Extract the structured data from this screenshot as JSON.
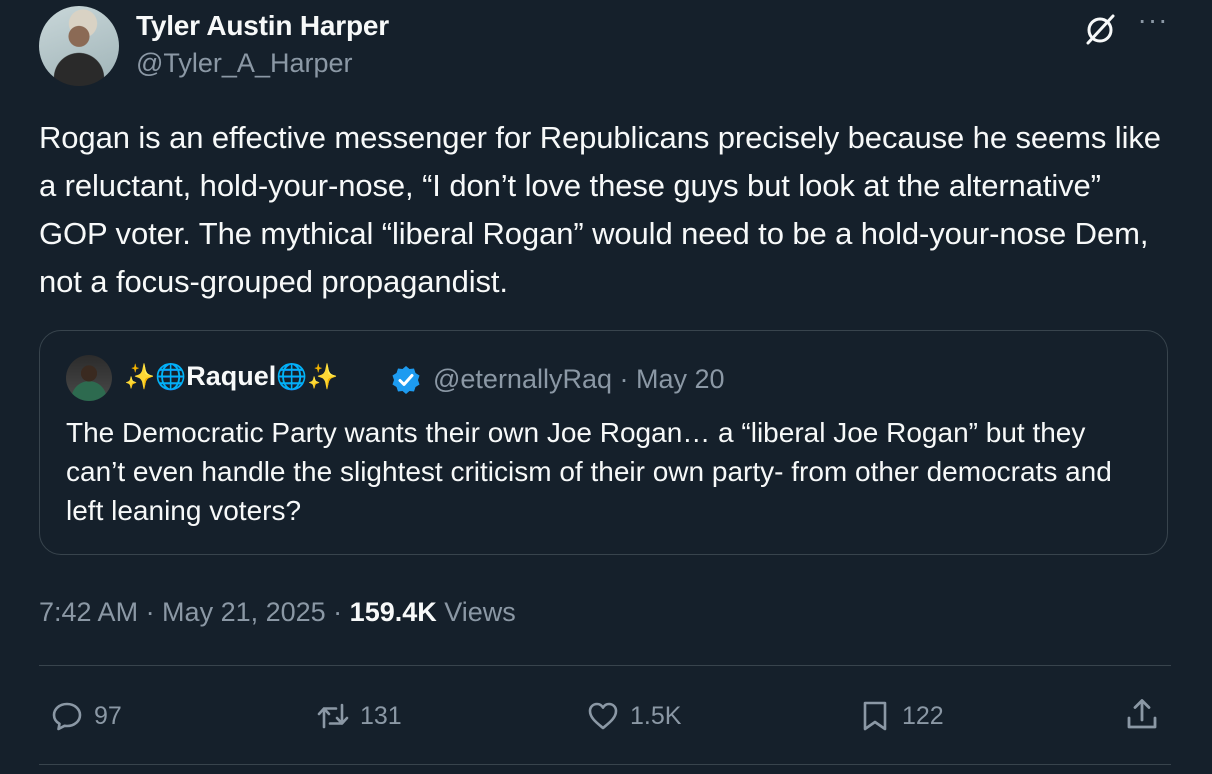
{
  "author": {
    "name": "Tyler Austin Harper",
    "handle": "@Tyler_A_Harper"
  },
  "header_icons": [
    "grok-icon",
    "more-icon"
  ],
  "more_label": "···",
  "tweet_text": "Rogan is an effective messenger for Republicans precisely because he seems like a reluctant, hold-your-nose, “I don’t love these guys but look at the alternative” GOP voter. The mythical “liberal Rogan” would need to be a hold-your-nose Dem, not a focus-grouped propagandist.",
  "quote": {
    "name_prefix": "✨🌐",
    "name": "Raquel",
    "name_suffix": "🌐✨",
    "verified": true,
    "handle_date": "@eternallyRaq · May 20",
    "text": "The Democratic Party wants their own Joe Rogan… a “liberal Joe Rogan” but they can’t even handle the slightest criticism of their own party- from other democrats and left leaning voters?"
  },
  "meta": {
    "time_date": "7:42 AM · May 21, 2025 · ",
    "views_count": "159.4K",
    "views_label": " Views"
  },
  "actions": {
    "replies": "97",
    "reposts": "131",
    "likes": "1.5K",
    "bookmarks": "122"
  },
  "colors": {
    "background": "#15202b",
    "text": "#f7f9f9",
    "secondary": "#8b98a5",
    "border": "#38444d",
    "verified": "#1d9bf0"
  }
}
